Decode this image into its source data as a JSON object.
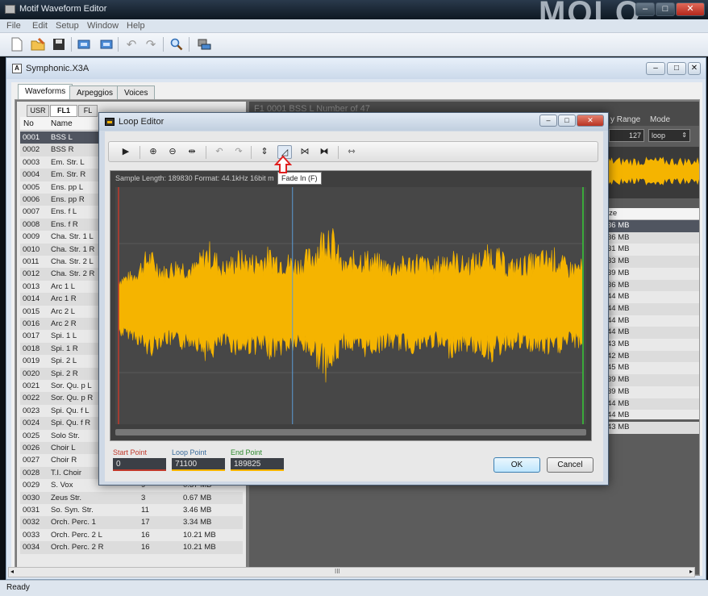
{
  "app": {
    "title": "Motif Waveform Editor",
    "menu": [
      "File",
      "Edit",
      "Setup",
      "Window",
      "Help"
    ],
    "toolbar_icons": [
      "new-icon",
      "open-icon",
      "save-icon",
      "import-icon",
      "export-icon",
      "undo-icon",
      "redo-icon",
      "search-icon",
      "device-icon"
    ],
    "background_text": "MOLO"
  },
  "doc": {
    "icon_letter": "A",
    "title": "Symphonic.X3A",
    "tabs": [
      "Waveforms",
      "Arpeggios",
      "Voices"
    ],
    "active_tab": "Waveforms",
    "subtabs": [
      "USR",
      "FL1",
      "FL"
    ],
    "active_subtab": "FL1",
    "columns": {
      "no": "No",
      "name": "Name"
    },
    "rows": [
      {
        "no": "0001",
        "name": "BSS L",
        "c3": "",
        "size": ""
      },
      {
        "no": "0002",
        "name": "BSS R",
        "c3": "",
        "size": ""
      },
      {
        "no": "0003",
        "name": "Em. Str. L",
        "c3": "",
        "size": ""
      },
      {
        "no": "0004",
        "name": "Em. Str. R",
        "c3": "",
        "size": ""
      },
      {
        "no": "0005",
        "name": "Ens. pp L",
        "c3": "",
        "size": ""
      },
      {
        "no": "0006",
        "name": "Ens. pp R",
        "c3": "",
        "size": ""
      },
      {
        "no": "0007",
        "name": "Ens. f L",
        "c3": "",
        "size": ""
      },
      {
        "no": "0008",
        "name": "Ens. f R",
        "c3": "",
        "size": ""
      },
      {
        "no": "0009",
        "name": "Cha. Str. 1 L",
        "c3": "",
        "size": ""
      },
      {
        "no": "0010",
        "name": "Cha. Str. 1 R",
        "c3": "",
        "size": ""
      },
      {
        "no": "0011",
        "name": "Cha. Str. 2 L",
        "c3": "",
        "size": ""
      },
      {
        "no": "0012",
        "name": "Cha. Str. 2 R",
        "c3": "",
        "size": ""
      },
      {
        "no": "0013",
        "name": "Arc 1 L",
        "c3": "",
        "size": ""
      },
      {
        "no": "0014",
        "name": "Arc 1 R",
        "c3": "",
        "size": ""
      },
      {
        "no": "0015",
        "name": "Arc 2 L",
        "c3": "",
        "size": ""
      },
      {
        "no": "0016",
        "name": "Arc 2 R",
        "c3": "",
        "size": ""
      },
      {
        "no": "0017",
        "name": "Spi. 1 L",
        "c3": "",
        "size": ""
      },
      {
        "no": "0018",
        "name": "Spi. 1 R",
        "c3": "",
        "size": ""
      },
      {
        "no": "0019",
        "name": "Spi. 2 L",
        "c3": "",
        "size": ""
      },
      {
        "no": "0020",
        "name": "Spi. 2 R",
        "c3": "",
        "size": ""
      },
      {
        "no": "0021",
        "name": "Sor. Qu. p L",
        "c3": "",
        "size": ""
      },
      {
        "no": "0022",
        "name": "Sor. Qu. p R",
        "c3": "",
        "size": ""
      },
      {
        "no": "0023",
        "name": "Spi. Qu. f L",
        "c3": "",
        "size": ""
      },
      {
        "no": "0024",
        "name": "Spi. Qu. f R",
        "c3": "",
        "size": ""
      },
      {
        "no": "0025",
        "name": "Solo Str.",
        "c3": "",
        "size": ""
      },
      {
        "no": "0026",
        "name": "Choir L",
        "c3": "",
        "size": ""
      },
      {
        "no": "0027",
        "name": "Choir R",
        "c3": "",
        "size": ""
      },
      {
        "no": "0028",
        "name": "T.I. Choir",
        "c3": "",
        "size": ""
      },
      {
        "no": "0029",
        "name": "S. Vox",
        "c3": "9",
        "size": "0.37 MB"
      },
      {
        "no": "0030",
        "name": "Zeus Str.",
        "c3": "3",
        "size": "0.67 MB"
      },
      {
        "no": "0031",
        "name": "So. Syn. Str.",
        "c3": "11",
        "size": "3.46 MB"
      },
      {
        "no": "0032",
        "name": "Orch. Perc. 1",
        "c3": "17",
        "size": "3.34 MB"
      },
      {
        "no": "0033",
        "name": "Orch. Perc. 2 L",
        "c3": "16",
        "size": "10.21 MB"
      },
      {
        "no": "0034",
        "name": "Orch. Perc. 2 R",
        "c3": "16",
        "size": "10.21 MB"
      }
    ],
    "right": {
      "header_fragment": "F1 0001 BSS L   Number of 47",
      "velocity_range_label": "y Range",
      "mode_label": "Mode",
      "velocity_value": "127",
      "mode_value": "loop",
      "size_header": "ize",
      "sizes": [
        "36 MB",
        "36 MB",
        "31 MB",
        "33 MB",
        "39 MB",
        "36 MB",
        "44 MB",
        "44 MB",
        "44 MB",
        "44 MB",
        "43 MB",
        "42 MB",
        "45 MB",
        "39 MB",
        "39 MB",
        "44 MB",
        "44 MB",
        "43 MB"
      ]
    },
    "scroll_marker": "III"
  },
  "status": "Ready",
  "loop_editor": {
    "title": "Loop Editor",
    "tools": [
      {
        "icon": "play-icon",
        "glyph": "▶"
      },
      {
        "icon": "zoom-in-icon",
        "glyph": "⊕"
      },
      {
        "icon": "zoom-out-icon",
        "glyph": "⊖"
      },
      {
        "icon": "zoom-fit-icon",
        "glyph": "⇹"
      },
      {
        "icon": "undo-icon",
        "glyph": "↶"
      },
      {
        "icon": "redo-icon",
        "glyph": "↷"
      },
      {
        "icon": "normalize-icon",
        "glyph": "⇕"
      },
      {
        "icon": "fade-in-icon",
        "glyph": "◿"
      },
      {
        "icon": "fade-out-crossfade-icon",
        "glyph": "⋈"
      },
      {
        "icon": "join-icon",
        "glyph": "⧓"
      },
      {
        "icon": "loop-region-icon",
        "glyph": "⇿"
      }
    ],
    "tooltip": "Fade In (F)",
    "info": "Sample Length: 189830   Format: 44.1kHz 16bit m",
    "start_label": "Start Point",
    "loop_label": "Loop Point",
    "end_label": "End Point",
    "start_value": "0",
    "loop_value": "71100",
    "end_value": "189825",
    "ok": "OK",
    "cancel": "Cancel",
    "colors": {
      "wave": "#f5b400",
      "start": "#c0392b",
      "loop": "#5a9bd5",
      "end": "#3aaa3a"
    }
  },
  "chart_data": {
    "type": "area",
    "title": "",
    "sample_length": 189830,
    "x_range": [
      0,
      189830
    ],
    "markers": {
      "start": 0,
      "loop": 71100,
      "end": 189825
    },
    "envelope_peaks": [
      0.25,
      0.3,
      0.55,
      0.35,
      0.45,
      0.38,
      0.62,
      0.4,
      0.52,
      0.48,
      0.55,
      0.5,
      0.45,
      0.58,
      0.9,
      0.4,
      0.55,
      0.5,
      0.42,
      0.45,
      0.5,
      0.4,
      0.55,
      0.45,
      0.5,
      0.6,
      0.42,
      0.45,
      0.5,
      0.55,
      0.4,
      0.42
    ]
  }
}
